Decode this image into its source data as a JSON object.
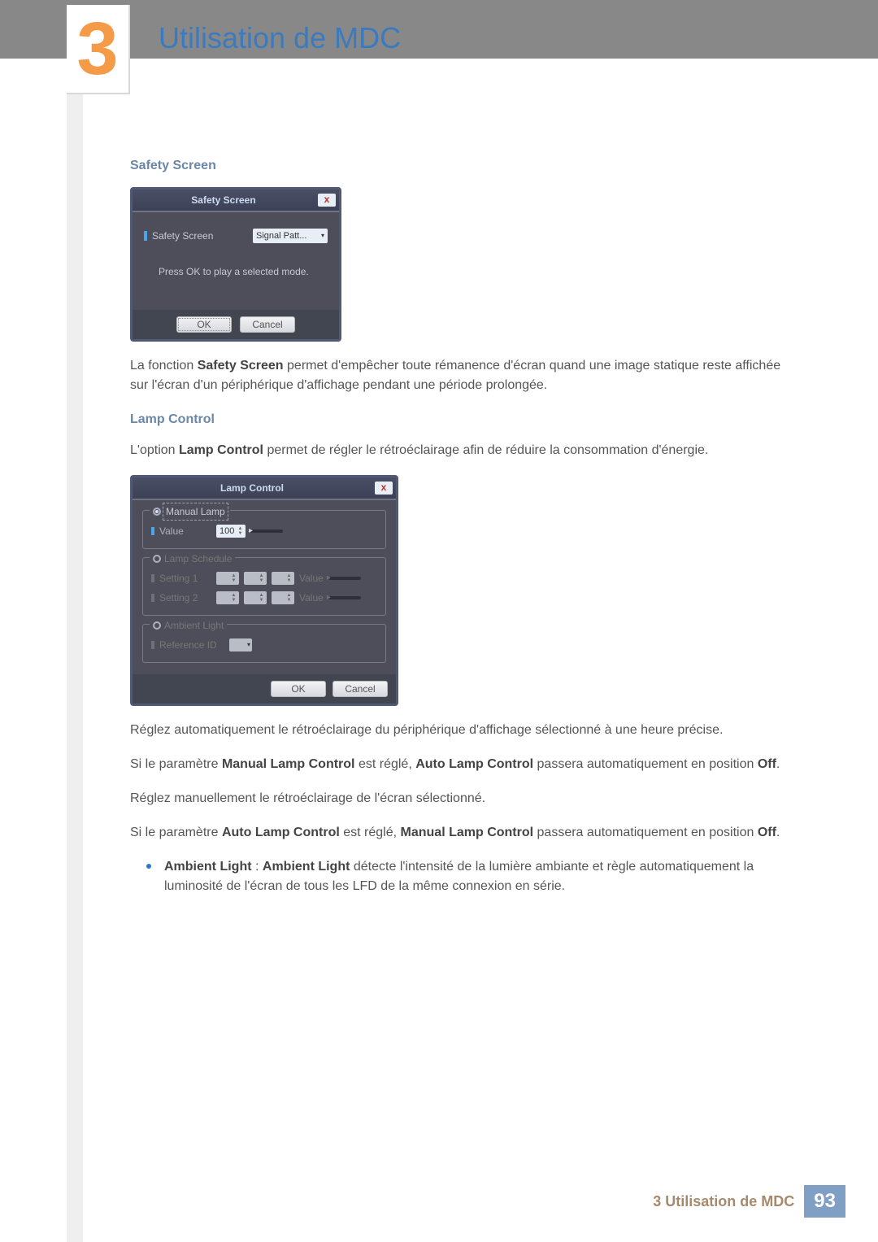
{
  "chapter": {
    "number": "3",
    "title": "Utilisation de MDC"
  },
  "sections": {
    "safety": {
      "heading": "Safety Screen",
      "para1_a": "La fonction ",
      "para1_b": "Safety Screen",
      "para1_c": " permet d'empêcher toute rémanence d'écran quand une image statique reste affichée sur l'écran d'un périphérique d'affichage pendant une période prolongée."
    },
    "lamp": {
      "heading": "Lamp Control",
      "intro_a": "L'option ",
      "intro_b": "Lamp Control",
      "intro_c": " permet de régler le rétroéclairage afin de réduire la consommation d'énergie.",
      "auto_para": "Réglez automatiquement le rétroéclairage du périphérique d'affichage sélectionné à une heure précise.",
      "manual_set_a": "Si le paramètre ",
      "manual_set_b": "Manual Lamp Control",
      "manual_set_c": " est réglé, ",
      "manual_set_d": "Auto Lamp Control",
      "manual_set_e": " passera automatiquement en position ",
      "manual_set_f": "Off",
      "manual_set_g": ".",
      "manual_para": "Réglez manuellement le rétroéclairage de l'écran sélectionné.",
      "auto_set_a": "Si le paramètre ",
      "auto_set_b": "Auto Lamp Control",
      "auto_set_c": " est réglé, ",
      "auto_set_d": "Manual Lamp Control",
      "auto_set_e": " passera automatiquement en position ",
      "auto_set_f": "Off",
      "auto_set_g": ".",
      "bullet_b1": "Ambient Light",
      "bullet_sep": " : ",
      "bullet_b2": "Ambient Light",
      "bullet_rest": " détecte l'intensité de la lumière ambiante et règle automatiquement la luminosité de l'écran de tous les LFD de la même connexion en série."
    }
  },
  "dlg_safety": {
    "title": "Safety Screen",
    "label": "Safety Screen",
    "select": "Signal Patt...",
    "hint": "Press OK to play a selected mode.",
    "ok": "OK",
    "cancel": "Cancel"
  },
  "dlg_lamp": {
    "title": "Lamp Control",
    "manual_legend": "Manual Lamp",
    "value_label": "Value",
    "value_num": "100",
    "schedule_legend": "Lamp Schedule",
    "setting1": "Setting 1",
    "setting2": "Setting 2",
    "sched_value": "Value",
    "ambient_legend": "Ambient Light",
    "ref_id": "Reference ID",
    "ok": "OK",
    "cancel": "Cancel"
  },
  "footer": {
    "text": "3 Utilisation de MDC",
    "page": "93"
  }
}
